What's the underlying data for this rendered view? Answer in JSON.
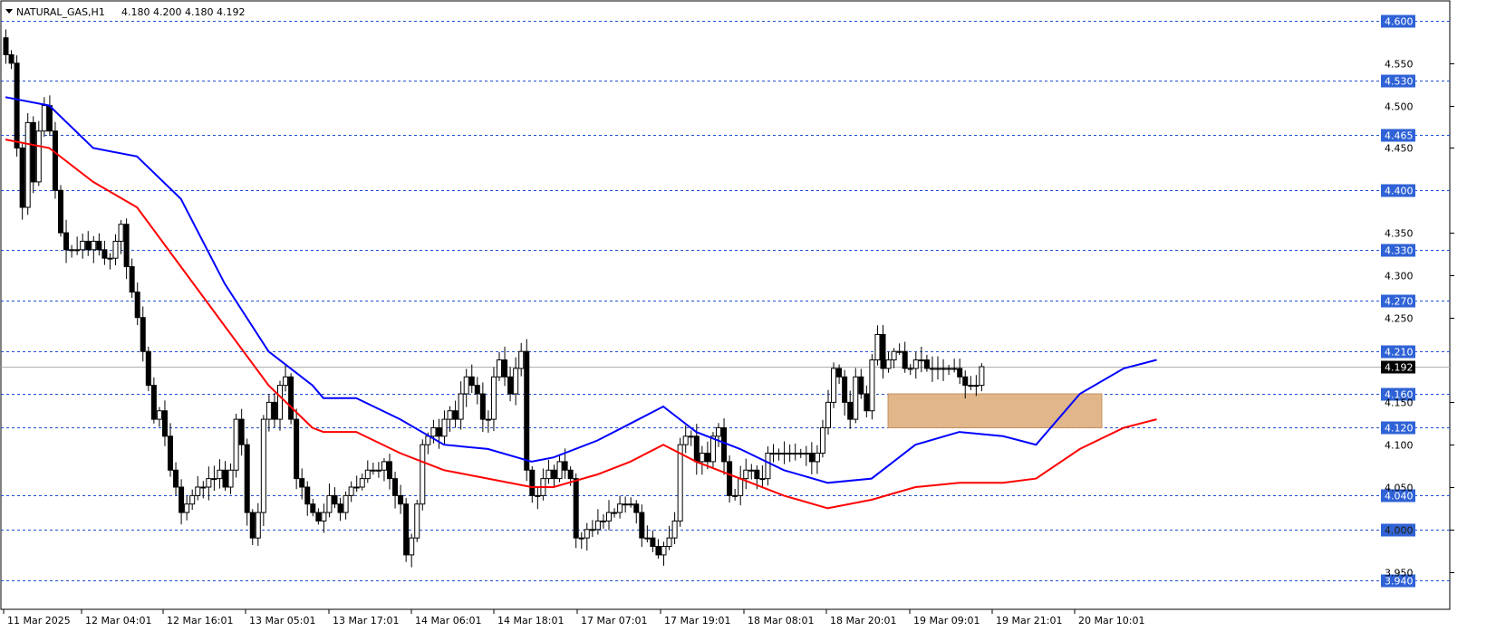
{
  "header": {
    "symbol": "NATURAL_GAS,H1",
    "ohlc": "4.180 4.200 4.180 4.192",
    "dropdown_icon": "triangle-down-icon"
  },
  "colors": {
    "background": "#ffffff",
    "grid_line": "#1f4fd1",
    "price_label_bg": "#2f62d6",
    "price_label_text": "#ffffff",
    "current_price_bg": "#000000",
    "candle_bull_fill": "#ffffff",
    "candle_bear_fill": "#000000",
    "candle_outline": "#000000",
    "ma_fast": "#0000ff",
    "ma_slow": "#ff0000",
    "zone_fill": "#e0b68a"
  },
  "chart_data": {
    "type": "candlestick",
    "ylim": [
      3.94,
      4.6
    ],
    "y_ticks": [
      "4.550",
      "4.500",
      "4.450",
      "4.350",
      "4.300",
      "4.250",
      "4.150",
      "4.100",
      "4.050",
      "4.000",
      "3.950"
    ],
    "level_lines": [
      "4.600",
      "4.530",
      "4.465",
      "4.400",
      "4.330",
      "4.270",
      "4.210",
      "4.160",
      "4.120",
      "4.040",
      "4.000",
      "3.940"
    ],
    "current_price": "4.192",
    "x_labels": [
      "11 Mar 2025",
      "12 Mar 04:01",
      "12 Mar 16:01",
      "13 Mar 05:01",
      "13 Mar 17:01",
      "14 Mar 06:01",
      "14 Mar 18:01",
      "17 Mar 07:01",
      "17 Mar 19:01",
      "18 Mar 08:01",
      "18 Mar 20:01",
      "19 Mar 09:01",
      "19 Mar 21:01",
      "20 Mar 10:01"
    ],
    "close": [
      4.56,
      4.55,
      4.45,
      4.38,
      4.48,
      4.41,
      4.47,
      4.5,
      4.47,
      4.4,
      4.35,
      4.33,
      4.33,
      4.33,
      4.34,
      4.33,
      4.34,
      4.33,
      4.32,
      4.32,
      4.34,
      4.36,
      4.31,
      4.28,
      4.25,
      4.21,
      4.17,
      4.13,
      4.14,
      4.11,
      4.07,
      4.05,
      4.02,
      4.03,
      4.04,
      4.05,
      4.05,
      4.06,
      4.06,
      4.07,
      4.05,
      4.07,
      4.13,
      4.1,
      4.02,
      3.99,
      4.02,
      4.13,
      4.15,
      4.13,
      4.17,
      4.18,
      4.13,
      4.06,
      4.05,
      4.03,
      4.02,
      4.01,
      4.02,
      4.04,
      4.03,
      4.02,
      4.04,
      4.05,
      4.05,
      4.06,
      4.07,
      4.07,
      4.07,
      4.08,
      4.06,
      4.04,
      4.03,
      3.97,
      3.99,
      4.03,
      4.1,
      4.11,
      4.12,
      4.11,
      4.13,
      4.14,
      4.13,
      4.16,
      4.18,
      4.17,
      4.16,
      4.13,
      4.13,
      4.18,
      4.2,
      4.18,
      4.16,
      4.19,
      4.21,
      4.07,
      4.04,
      4.04,
      4.06,
      4.07,
      4.06,
      4.08,
      4.07,
      4.06,
      3.99,
      3.99,
      4.0,
      4.0,
      4.01,
      4.01,
      4.02,
      4.02,
      4.03,
      4.03,
      4.03,
      4.02,
      3.99,
      3.99,
      3.98,
      3.97,
      3.98,
      3.99,
      4.01,
      4.1,
      4.11,
      4.11,
      4.08,
      4.09,
      4.08,
      4.11,
      4.12,
      4.08,
      4.04,
      4.04,
      4.06,
      4.07,
      4.07,
      4.06,
      4.06,
      4.09,
      4.09,
      4.09,
      4.09,
      4.09,
      4.09,
      4.09,
      4.09,
      4.08,
      4.09,
      4.12,
      4.15,
      4.19,
      4.18,
      4.15,
      4.13,
      4.18,
      4.16,
      4.14,
      4.2,
      4.23,
      4.19,
      4.2,
      4.21,
      4.21,
      4.19,
      4.19,
      4.2,
      4.2,
      4.19,
      4.19,
      4.19,
      4.19,
      4.19,
      4.19,
      4.18,
      4.17,
      4.17,
      4.17,
      4.192
    ],
    "ma_fast_points": [
      [
        0,
        4.51
      ],
      [
        8,
        4.5
      ],
      [
        16,
        4.45
      ],
      [
        24,
        4.44
      ],
      [
        32,
        4.39
      ],
      [
        40,
        4.29
      ],
      [
        48,
        4.21
      ],
      [
        56,
        4.17
      ],
      [
        58,
        4.155
      ],
      [
        64,
        4.155
      ],
      [
        72,
        4.13
      ],
      [
        80,
        4.1
      ],
      [
        88,
        4.095
      ],
      [
        96,
        4.08
      ],
      [
        100,
        4.085
      ],
      [
        108,
        4.105
      ],
      [
        114,
        4.125
      ],
      [
        120,
        4.145
      ],
      [
        126,
        4.115
      ],
      [
        134,
        4.095
      ],
      [
        142,
        4.07
      ],
      [
        150,
        4.055
      ],
      [
        158,
        4.06
      ],
      [
        166,
        4.1
      ],
      [
        174,
        4.115
      ],
      [
        182,
        4.11
      ],
      [
        188,
        4.1
      ],
      [
        196,
        4.16
      ],
      [
        204,
        4.19
      ],
      [
        210,
        4.2
      ]
    ],
    "ma_slow_points": [
      [
        0,
        4.46
      ],
      [
        8,
        4.45
      ],
      [
        16,
        4.41
      ],
      [
        24,
        4.38
      ],
      [
        32,
        4.31
      ],
      [
        40,
        4.24
      ],
      [
        48,
        4.17
      ],
      [
        56,
        4.12
      ],
      [
        58,
        4.115
      ],
      [
        64,
        4.115
      ],
      [
        72,
        4.09
      ],
      [
        80,
        4.07
      ],
      [
        88,
        4.06
      ],
      [
        96,
        4.05
      ],
      [
        100,
        4.05
      ],
      [
        108,
        4.065
      ],
      [
        114,
        4.08
      ],
      [
        120,
        4.1
      ],
      [
        126,
        4.08
      ],
      [
        134,
        4.06
      ],
      [
        142,
        4.04
      ],
      [
        150,
        4.025
      ],
      [
        158,
        4.035
      ],
      [
        166,
        4.05
      ],
      [
        174,
        4.055
      ],
      [
        182,
        4.055
      ],
      [
        188,
        4.06
      ],
      [
        196,
        4.095
      ],
      [
        204,
        4.12
      ],
      [
        210,
        4.13
      ]
    ],
    "zone": {
      "from_index": 161,
      "to_index": 200,
      "low": 4.12,
      "high": 4.16
    }
  }
}
